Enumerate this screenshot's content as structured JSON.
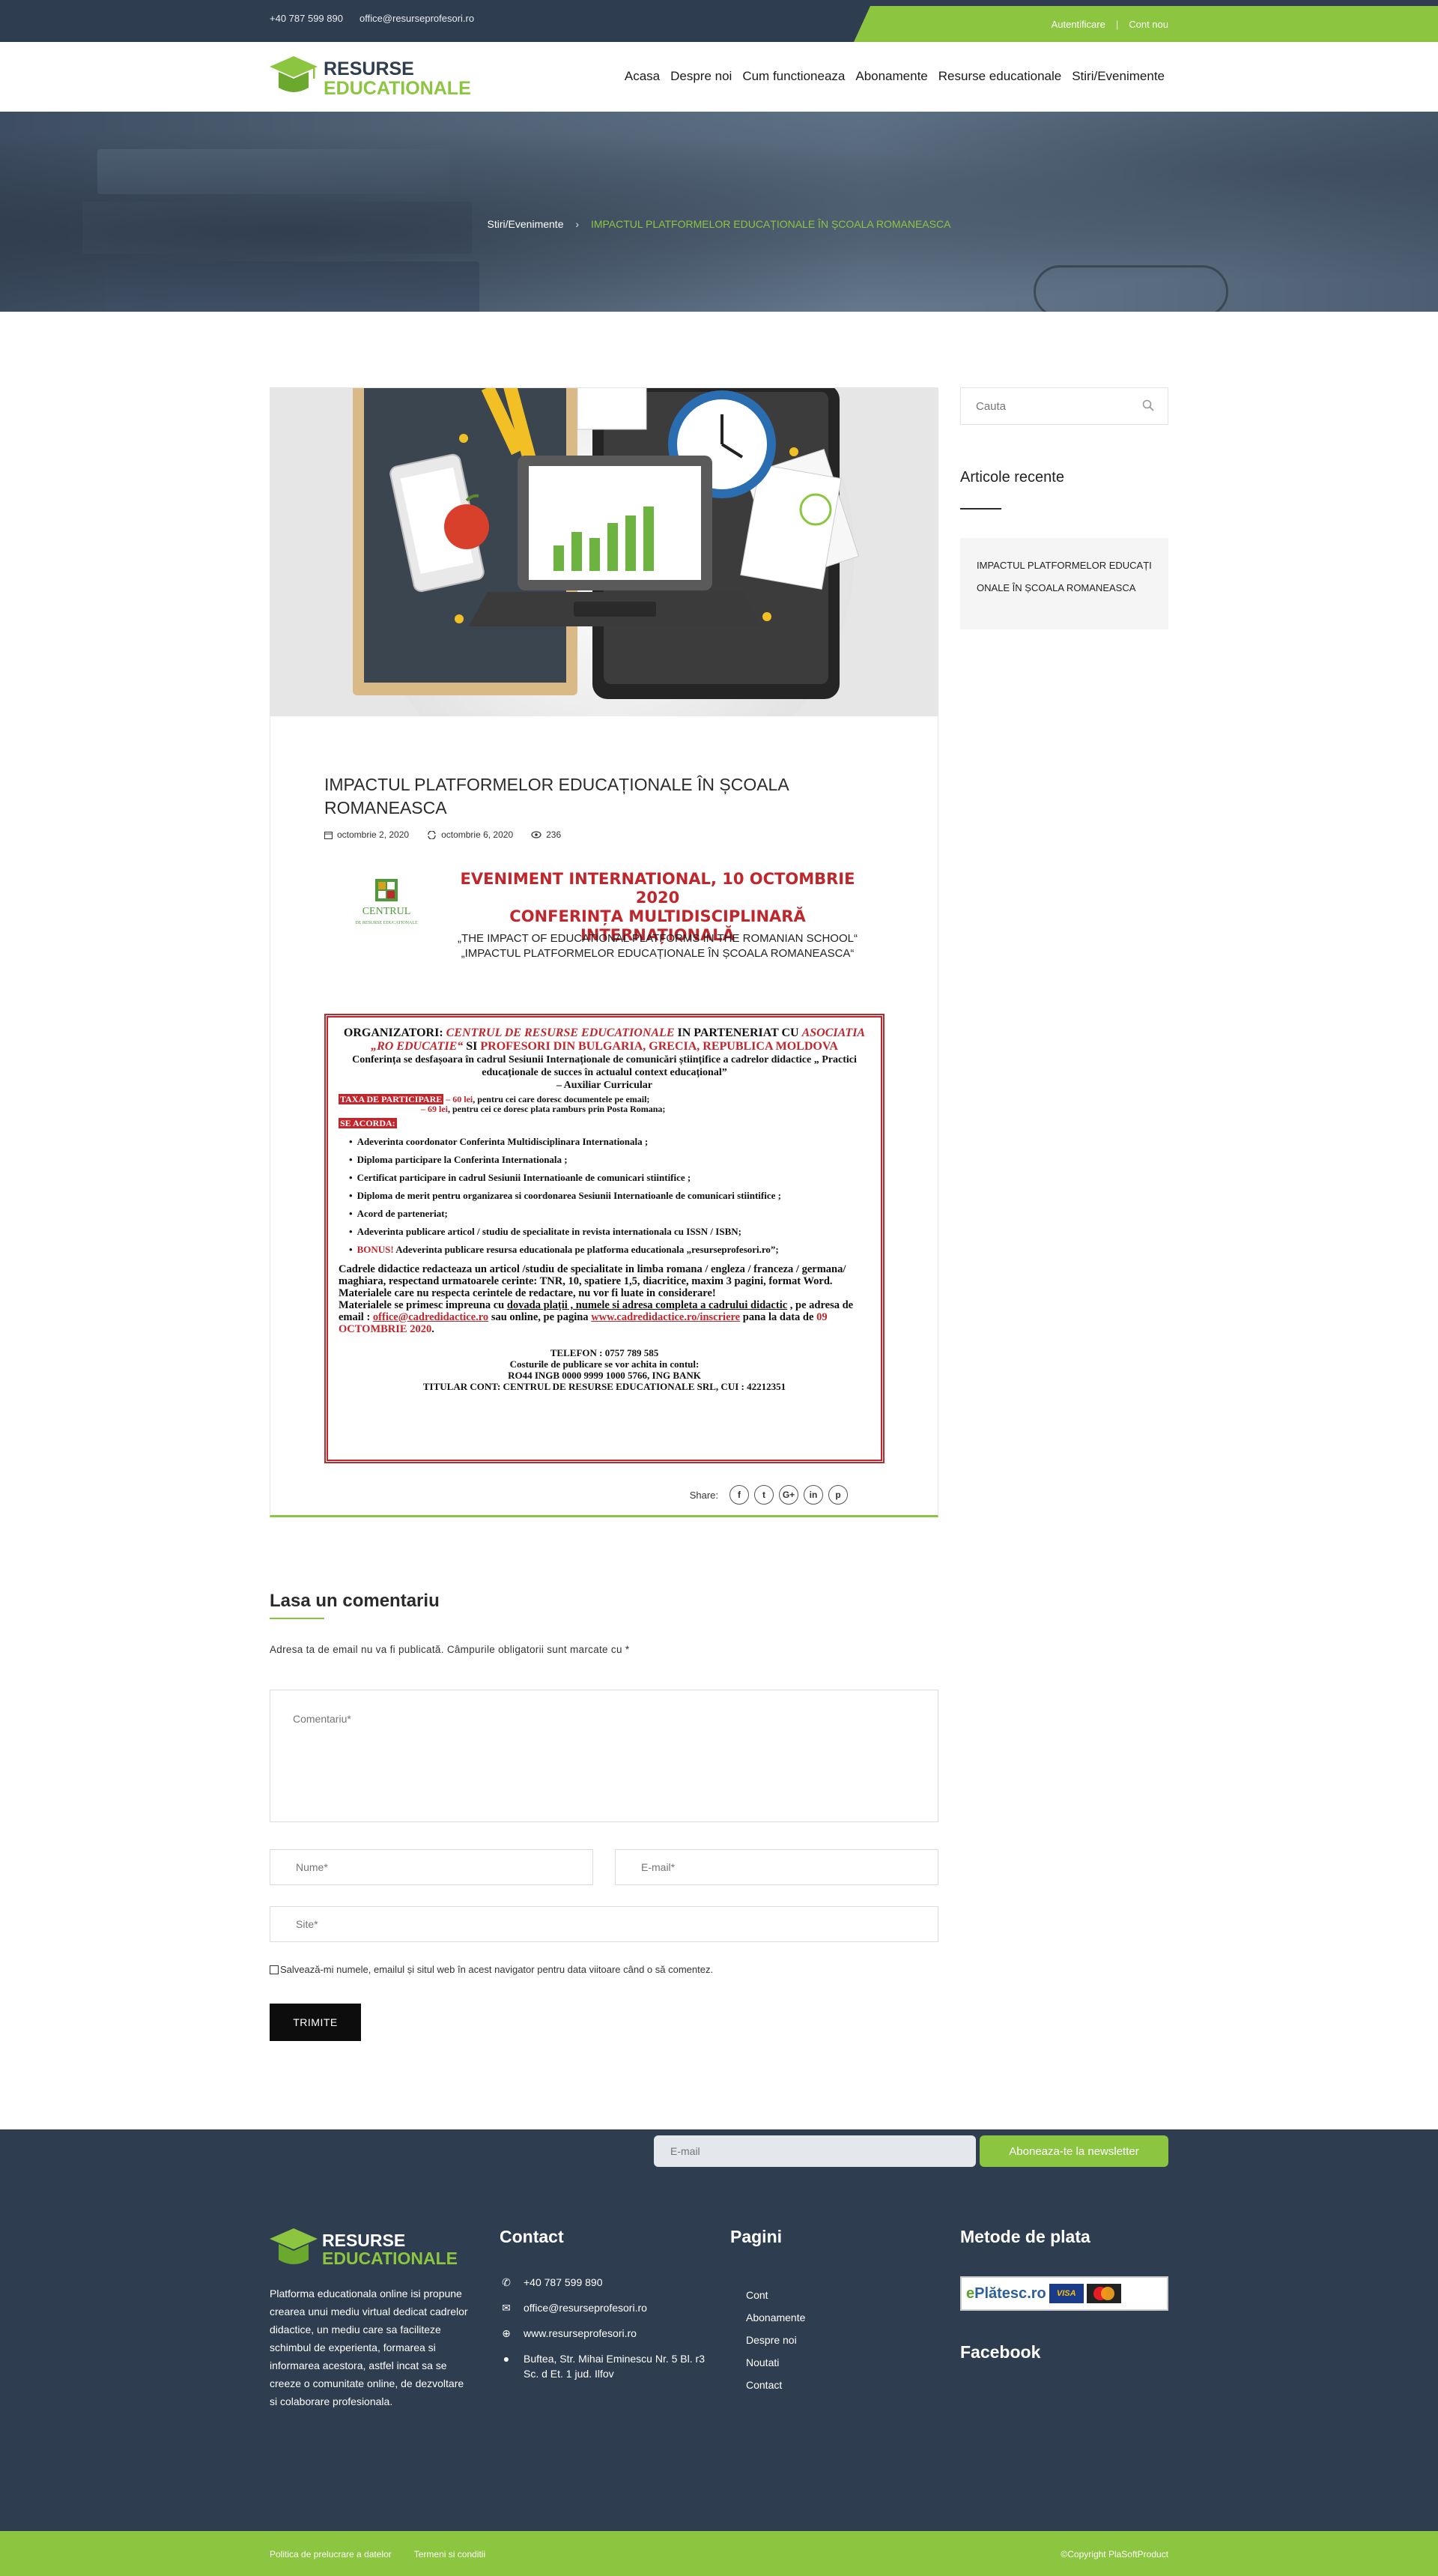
{
  "topbar": {
    "phone": "+40 787 599 890",
    "email": "office@resurseprofesori.ro",
    "login": "Autentificare",
    "separator": "|",
    "register": "Cont nou"
  },
  "header": {
    "logo_top": "RESURSE",
    "logo_bottom": "EDUCATIONALE",
    "nav": [
      "Acasa",
      "Despre noi",
      "Cum functioneaza",
      "Abonamente",
      "Resurse educationale",
      "Stiri/Evenimente"
    ]
  },
  "breadcrumb": {
    "parent": "Stiri/Evenimente",
    "arrow": "›",
    "current": "IMPACTUL PLATFORMELOR EDUCAȚIONALE ÎN ȘCOALA ROMANEASCA"
  },
  "article": {
    "title": "IMPACTUL PLATFORMELOR EDUCAȚIONALE ÎN ȘCOALA ROMANEASCA",
    "published": "octombrie 2, 2020",
    "updated": "octombrie 6, 2020",
    "views": "236"
  },
  "flyer": {
    "logo_name": "CENTRUL",
    "logo_sub": "DE RESURSE EDUCATIONALE",
    "event_line1": "EVENIMENT INTERNATIONAL, 10 OCTOMBRIE 2020",
    "event_line2": "CONFERINȚA MULTIDISCIPLINARĂ INTERNAȚIONALĂ",
    "title_en": "„THE IMPACT OF EDUCATIONAL PLATFORMS IN THE ROMANIAN SCHOOL“",
    "title_ro": "„IMPACTUL PLATFORMELOR EDUCAȚIONALE ÎN ȘCOALA ROMANEASCA“",
    "org_prefix": "ORGANIZATORI: ",
    "org_name": "CENTRUL DE RESURSE EDUCATIONALE",
    "org_mid": " IN PARTENERIAT CU",
    "org_asoc": "ASOCIATIA „RO EDUCATIE“",
    "org_and": " SI ",
    "org_partners": "PROFESORI DIN BULGARIA, GRECIA, REPUBLICA MOLDOVA",
    "session": "Conferința se desfașoara în cadrul Sesiunii Internaționale de comunicări științifice a cadrelor didactice „ Practici educaționale de succes în actualul context educațional”",
    "aux": "– Auxiliar Curricular",
    "tax_label": "TAXA DE PARTICIPARE",
    "tax1_amount": " – 60 lei",
    "tax1_text": ", pentru cei care doresc documentele pe email;",
    "tax2_amount": "– 69 lei",
    "tax2_text": ", pentru cei ce doresc plata ramburs prin Posta Romana;",
    "grants_label": "SE ACORDA:",
    "grants": [
      "Adeverinta coordonator Conferinta Multidisciplinara Internationala ;",
      "Diploma participare la Conferinta Internationala ;",
      "Certificat participare in cadrul Sesiunii Internatioanle de comunicari stiintifice ;",
      "Diploma de merit pentru organizarea si coordonarea Sesiunii Internatioanle de comunicari stiintifice ;",
      "Acord de parteneriat;",
      "Adeverinta publicare articol / studiu de specialitate in revista internationala cu ISSN / ISBN;"
    ],
    "bonus_label": "BONUS!",
    "bonus_text": " Adeverinta publicare resursa educationala pe platforma educationala „resurseprofesori.ro”;",
    "body1": "Cadrele didactice redacteaza un articol /studiu de specialitate in limba romana / engleza / franceza / germana/ maghiara, respectand urmatoarele cerinte: TNR, 10, spatiere 1,5, diacritice, maxim 3 pagini, format Word.",
    "body2": "Materialele care nu respecta cerintele de redactare, nu vor fi luate in considerare!",
    "body3_a": "Materialele se primesc impreuna cu ",
    "body3_b": "dovada plații",
    "body3_c": " , numele si adresa completa a cadrului didactic",
    "body3_d": " , pe adresa de email : ",
    "body3_email": "office@cadredidactice.ro",
    "body3_e": " sau online, pe pagina ",
    "body3_url": "www.cadredidactice.ro/inscriere",
    "body3_f": " pana la data de ",
    "body3_date": "09 OCTOMBRIE 2020",
    "phone": "TELEFON : 0757 789 585",
    "pay_note": "Costurile de publicare se vor achita in contul:",
    "iban": "RO44 INGB 0000 9999 1000 5766, ING BANK",
    "holder": "TITULAR CONT: CENTRUL DE RESURSE EDUCATIONALE SRL, CUI : 42212351"
  },
  "share": {
    "label": "Share:",
    "icons": [
      "f",
      "t",
      "G+",
      "in",
      "p"
    ]
  },
  "sidebar": {
    "search_placeholder": "Cauta",
    "recent_title": "Articole recente",
    "recent_item": "IMPACTUL PLATFORMELOR EDUCAȚIONALE ÎN ȘCOALA ROMANEASCA"
  },
  "comments": {
    "title": "Lasa un comentariu",
    "note": "Adresa ta de email nu va fi publicată. Câmpurile obligatorii sunt marcate cu *",
    "comment_placeholder": "Comentariu*",
    "name_placeholder": "Nume*",
    "email_placeholder": "E-mail*",
    "site_placeholder": "Site*",
    "save_label": "Salvează-mi numele, emailul și situl web în acest navigator pentru data viitoare când o să comentez.",
    "submit": "TRIMITE"
  },
  "footer": {
    "newsletter_placeholder": "E-mail",
    "newsletter_button": "Aboneaza-te la newsletter",
    "logo_top": "RESURSE",
    "logo_bottom": "EDUCATIONALE",
    "about": "Platforma educationala online isi propune crearea unui mediu virtual dedicat cadrelor didactice, un mediu care sa faciliteze schimbul de experienta, formarea si informarea acestora, astfel incat sa se creeze o comunitate online, de dezvoltare si colaborare profesionala.",
    "contact_title": "Contact",
    "phone": "+40 787 599 890",
    "email": "office@resurseprofesori.ro",
    "site": "www.resurseprofesori.ro",
    "address": "Buftea, Str. Mihai Eminescu Nr. 5 Bl. r3 Sc. d Et. 1 jud. Ilfov",
    "pages_title": "Pagini",
    "pages": [
      "Cont",
      "Abonamente",
      "Despre noi",
      "Noutati",
      "Contact"
    ],
    "payment_title": "Metode de plata",
    "platesc": "Plătesc",
    "platesc_tld": ".ro",
    "visa": "VISA",
    "facebook_title": "Facebook"
  },
  "bottombar": {
    "policy": "Politica de prelucrare a datelor",
    "terms": "Termeni si conditii",
    "copyright": "©Copyright PlaSoftProduct"
  },
  "colors": {
    "accent": "#8cc540",
    "dark": "#2f3d50",
    "flyer_red": "#c0272d"
  }
}
